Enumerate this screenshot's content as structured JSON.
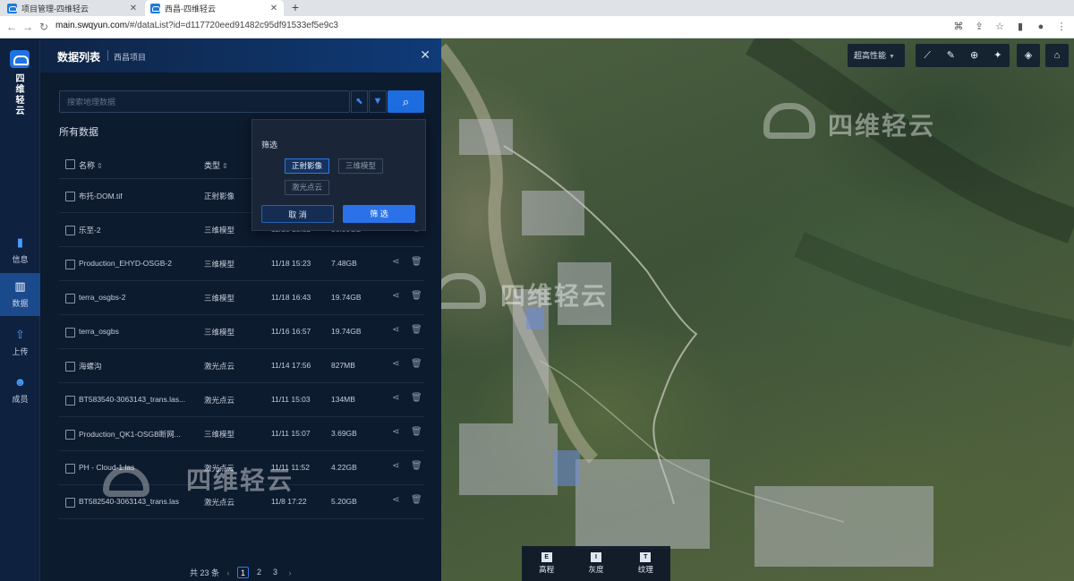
{
  "browser": {
    "tabs": [
      {
        "title": "项目管理-四维轻云",
        "active": false
      },
      {
        "title": "西昌-四维轻云",
        "active": true
      }
    ],
    "url_host": "main.swqyun.com",
    "url_rest": "/#/dataList?id=d117720eed91482c95df91533ef5e9c3"
  },
  "sidebar": {
    "brand": [
      "四",
      "维",
      "轻",
      "云"
    ],
    "items": [
      {
        "label": "信息",
        "icon": "info-icon",
        "active": false
      },
      {
        "label": "数据",
        "icon": "data-icon",
        "active": true
      },
      {
        "label": "上传",
        "icon": "upload-icon",
        "active": false
      },
      {
        "label": "成员",
        "icon": "members-icon",
        "active": false
      }
    ]
  },
  "panel": {
    "title": "数据列表",
    "subtitle": "西昌项目",
    "search_placeholder": "搜索地理数据",
    "section_title": "所有数据",
    "columns": {
      "name": "名称",
      "type": "类型"
    },
    "rows": [
      {
        "name": "布托-DOM.tif",
        "type": "正射影像",
        "date": "",
        "size": ""
      },
      {
        "name": "乐至-2",
        "type": "三维模型",
        "date": "11/18 15:32",
        "size": "36.90GB"
      },
      {
        "name": "Production_EHYD-OSGB-2",
        "type": "三维模型",
        "date": "11/18 15:23",
        "size": "7.48GB"
      },
      {
        "name": "terra_osgbs-2",
        "type": "三维模型",
        "date": "11/18 16:43",
        "size": "19.74GB"
      },
      {
        "name": "terra_osgbs",
        "type": "三维模型",
        "date": "11/16 16:57",
        "size": "19.74GB"
      },
      {
        "name": "海螺沟",
        "type": "激光点云",
        "date": "11/14 17:56",
        "size": "827MB"
      },
      {
        "name": "BT583540-3063143_trans.las...",
        "type": "激光点云",
        "date": "11/11 15:03",
        "size": "134MB"
      },
      {
        "name": "Production_QK1-OSGB断网...",
        "type": "三维模型",
        "date": "11/11 15:07",
        "size": "3.69GB"
      },
      {
        "name": "PH - Cloud-1.las",
        "type": "激光点云",
        "date": "11/11 11:52",
        "size": "4.22GB"
      },
      {
        "name": "BT582540-3063143_trans.las",
        "type": "激光点云",
        "date": "11/8 17:22",
        "size": "5.20GB"
      }
    ],
    "pager": {
      "total": "共 23 条",
      "pages": [
        "1",
        "2",
        "3"
      ],
      "current": "1"
    }
  },
  "filter_popup": {
    "title": "筛选",
    "options": [
      {
        "label": "正射影像",
        "selected": true
      },
      {
        "label": "三维模型",
        "selected": false
      },
      {
        "label": "激光点云",
        "selected": false
      }
    ],
    "cancel": "取 消",
    "confirm": "筛 选"
  },
  "map": {
    "performance": "超高性能",
    "watermark": "四维轻云",
    "bottom_tools": [
      {
        "label": "高程",
        "icon": "E"
      },
      {
        "label": "灰度",
        "icon": "I"
      },
      {
        "label": "纹理",
        "icon": "T"
      }
    ]
  }
}
